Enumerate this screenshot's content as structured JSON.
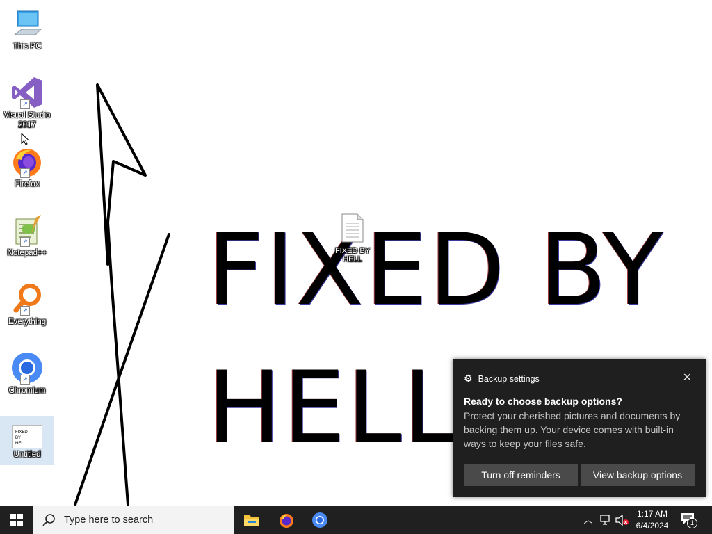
{
  "desktop": {
    "icons": [
      {
        "label": "This PC"
      },
      {
        "label": "Visual Studio 2017"
      },
      {
        "label": "Firefox"
      },
      {
        "label": "Notepad++"
      },
      {
        "label": "Everything"
      },
      {
        "label": "Chromium"
      },
      {
        "label": "Untitled"
      }
    ],
    "untitled_thumb_text": "FIXED BY HELL",
    "file": {
      "label": "FIXED BY HELL"
    },
    "wallpaper_lines": [
      "FIXED BY",
      "HELL"
    ]
  },
  "toast": {
    "app_name": "Backup settings",
    "title": "Ready to choose backup options?",
    "body": "Protect your cherished pictures and documents by backing them up. Your device comes with built-in ways to keep your files safe.",
    "btn_left": "Turn off reminders",
    "btn_right": "View backup options",
    "close_glyph": "✕"
  },
  "taskbar": {
    "search_placeholder": "Type here to search",
    "apps": [
      "file-explorer-icon",
      "firefox-icon",
      "chromium-icon"
    ],
    "time": "1:17 AM",
    "date": "6/4/2024",
    "notification_count": "1"
  },
  "colors": {
    "taskbar": "#202020",
    "toast_bg": "#1f1f1f",
    "toast_btn": "#4a4a4a"
  }
}
